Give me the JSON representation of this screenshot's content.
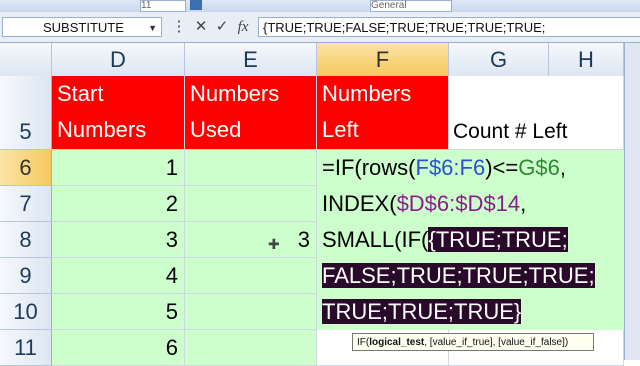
{
  "ribbon": {
    "font_size": "11",
    "number_format": "General"
  },
  "formula_bar": {
    "name_box": "SUBSTITUTE",
    "cancel_glyph": "✕",
    "enter_glyph": "✓",
    "fx_label": "fx",
    "content": "{TRUE;TRUE;FALSE;TRUE;TRUE;TRUE;TRUE;"
  },
  "columns": [
    "D",
    "E",
    "F",
    "G",
    "H"
  ],
  "rows": [
    "5",
    "6",
    "7",
    "8",
    "9",
    "10",
    "11"
  ],
  "headers": {
    "d_line1": "Start",
    "d_line2": "Numbers",
    "e_line1": "Numbers",
    "e_line2": "Used",
    "f_line1": "Numbers",
    "f_line2": "Left",
    "g": "Count # Left"
  },
  "start_numbers": [
    "1",
    "2",
    "3",
    "4",
    "5",
    "6"
  ],
  "numbers_used": [
    "",
    "",
    "3",
    "",
    "",
    ""
  ],
  "formula_lines": {
    "l1_a": "=IF(rows(",
    "l1_b": "F$6:F6",
    "l1_c": ")<=",
    "l1_d": "G$6",
    "l1_e": ",",
    "l2_a": "INDEX(",
    "l2_b": "$D$6:$D$14",
    "l2_c": ",",
    "l3_a": "SMALL(IF(",
    "l3_b": "{TRUE;TRUE;",
    "l4": "FALSE;TRUE;TRUE;TRUE;",
    "l5": "TRUE;TRUE;TRUE}"
  },
  "tooltip": {
    "fn": "IF(",
    "arg1": "logical_test",
    "rest": ", [value_if_true], [value_if_false])"
  },
  "colors": {
    "header_red": "#ff0000",
    "cell_green": "#ccffcc",
    "selection_gold": "#f7c95f"
  }
}
